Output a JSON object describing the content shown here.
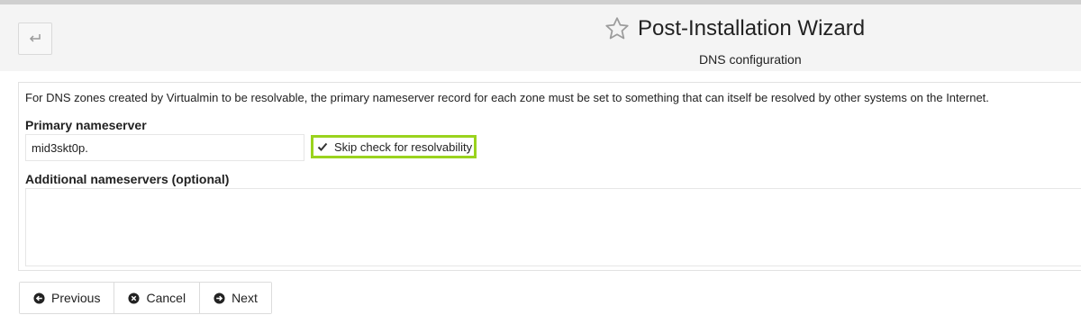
{
  "header": {
    "back_icon": "return-arrow-icon",
    "star_icon": "star-outline-icon",
    "title": "Post-Installation Wizard",
    "subtitle": "DNS configuration"
  },
  "form": {
    "intro": "For DNS zones created by Virtualmin to be resolvable, the primary nameserver record for each zone must be set to something that can itself be resolved by other systems on the Internet.",
    "primary_label": "Primary nameserver",
    "primary_value": "mid3skt0p.",
    "skip_check": {
      "label": "Skip check for resolvability",
      "checked": true,
      "highlight_color": "#9ad31e"
    },
    "additional_label": "Additional nameservers (optional)",
    "additional_value": ""
  },
  "buttons": {
    "previous": {
      "label": "Previous",
      "icon": "circle-arrow-left-icon"
    },
    "cancel": {
      "label": "Cancel",
      "icon": "circle-x-icon"
    },
    "next": {
      "label": "Next",
      "icon": "circle-arrow-right-icon"
    }
  }
}
